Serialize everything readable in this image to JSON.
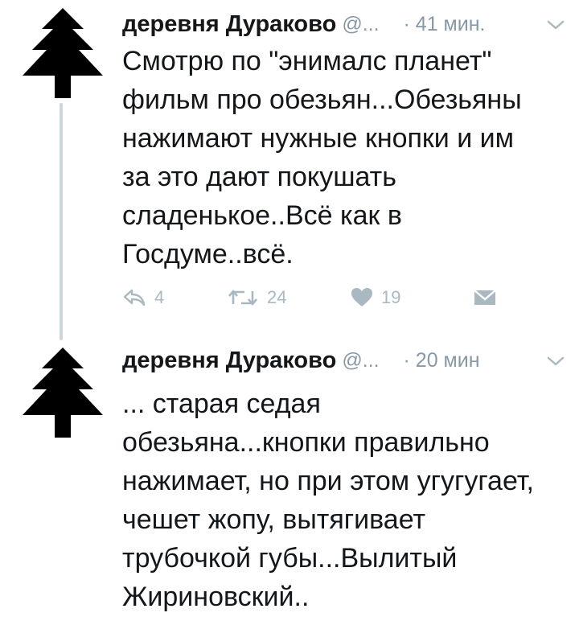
{
  "tweets": [
    {
      "name": "деревня Дураково",
      "handle": "@...",
      "time": "· 41 мин.",
      "text": "Смотрю по \"энималс планет\"\nфильм про обезьян...Обезьяны\nнажимают нужные кнопки и им\nза это дают покушать\nсладенькое..Всё как в\nГосдуме..всё.",
      "actions": {
        "replies": "4",
        "retweets": "24",
        "likes": "19"
      }
    },
    {
      "name": "деревня Дураково",
      "handle": "@...",
      "time": "· 20 мин",
      "text": "... старая седая\nобезьяна...кнопки правильно\nнажимает, но при этом угугугает,\nчешет жопу, вытягивает\nтрубочкой губы...Вылитый\nЖириновский.."
    }
  ],
  "icons": {
    "avatar": "fir-tree-icon",
    "menu": "chevron-down-icon",
    "reply": "reply-icon",
    "retweet": "retweet-icon",
    "like": "heart-icon",
    "dm": "envelope-icon"
  },
  "colors": {
    "text": "#14171a",
    "muted": "#8899a6",
    "action": "#aab8c2",
    "thread": "#ccd6dd"
  }
}
